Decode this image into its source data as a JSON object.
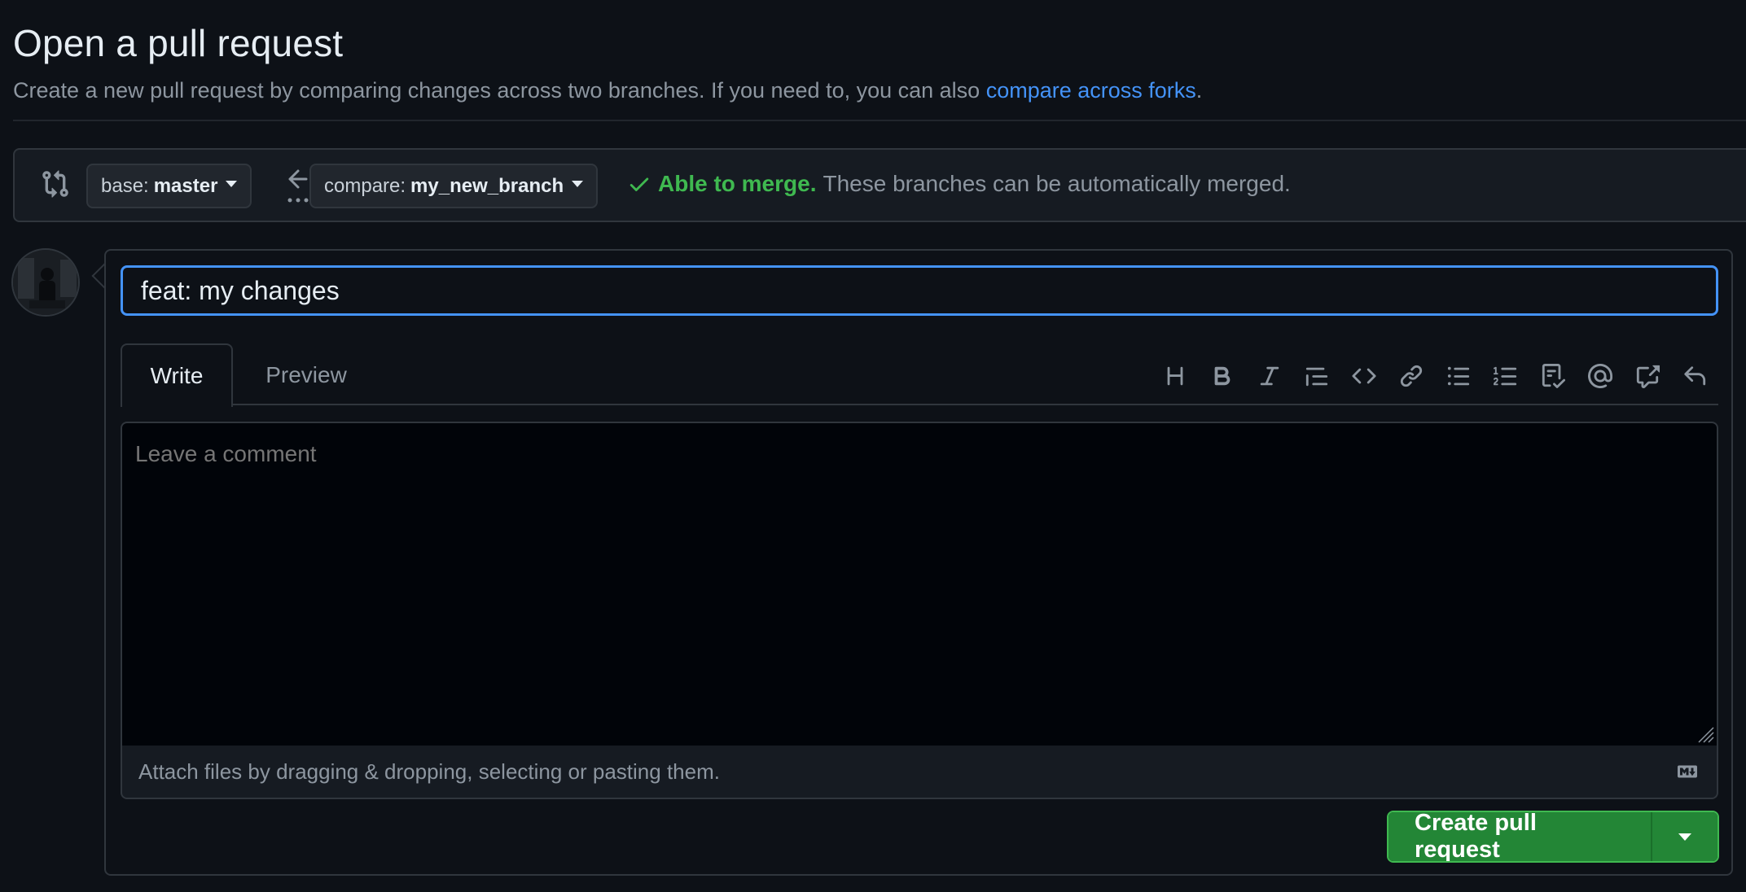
{
  "page": {
    "title": "Open a pull request",
    "subtitle_prefix": "Create a new pull request by comparing changes across two branches. If you need to, you can also ",
    "subtitle_link": "compare across forks",
    "subtitle_suffix": "."
  },
  "range": {
    "base_key": "base:",
    "base_value": "master",
    "compare_key": "compare:",
    "compare_value": "my_new_branch",
    "merge_ok": "Able to merge.",
    "merge_text": "These branches can be automatically merged."
  },
  "form": {
    "title_value": "feat: my changes",
    "tabs": [
      {
        "label": "Write"
      },
      {
        "label": "Preview"
      }
    ],
    "comment_placeholder": "Leave a comment",
    "attach_text": "Attach files by dragging & dropping, selecting or pasting them.",
    "create_label": "Create pull request"
  },
  "colors": {
    "background": "#0d1117",
    "accent_blue": "#4493f8",
    "success_green": "#3fb950",
    "primary_button": "#238636"
  },
  "icons": {
    "toolbar": [
      "heading-icon",
      "bold-icon",
      "italic-icon",
      "quote-icon",
      "code-icon",
      "link-icon",
      "unordered-list-icon",
      "ordered-list-icon",
      "task-list-icon",
      "mention-icon",
      "cross-reference-icon",
      "reply-icon"
    ]
  }
}
